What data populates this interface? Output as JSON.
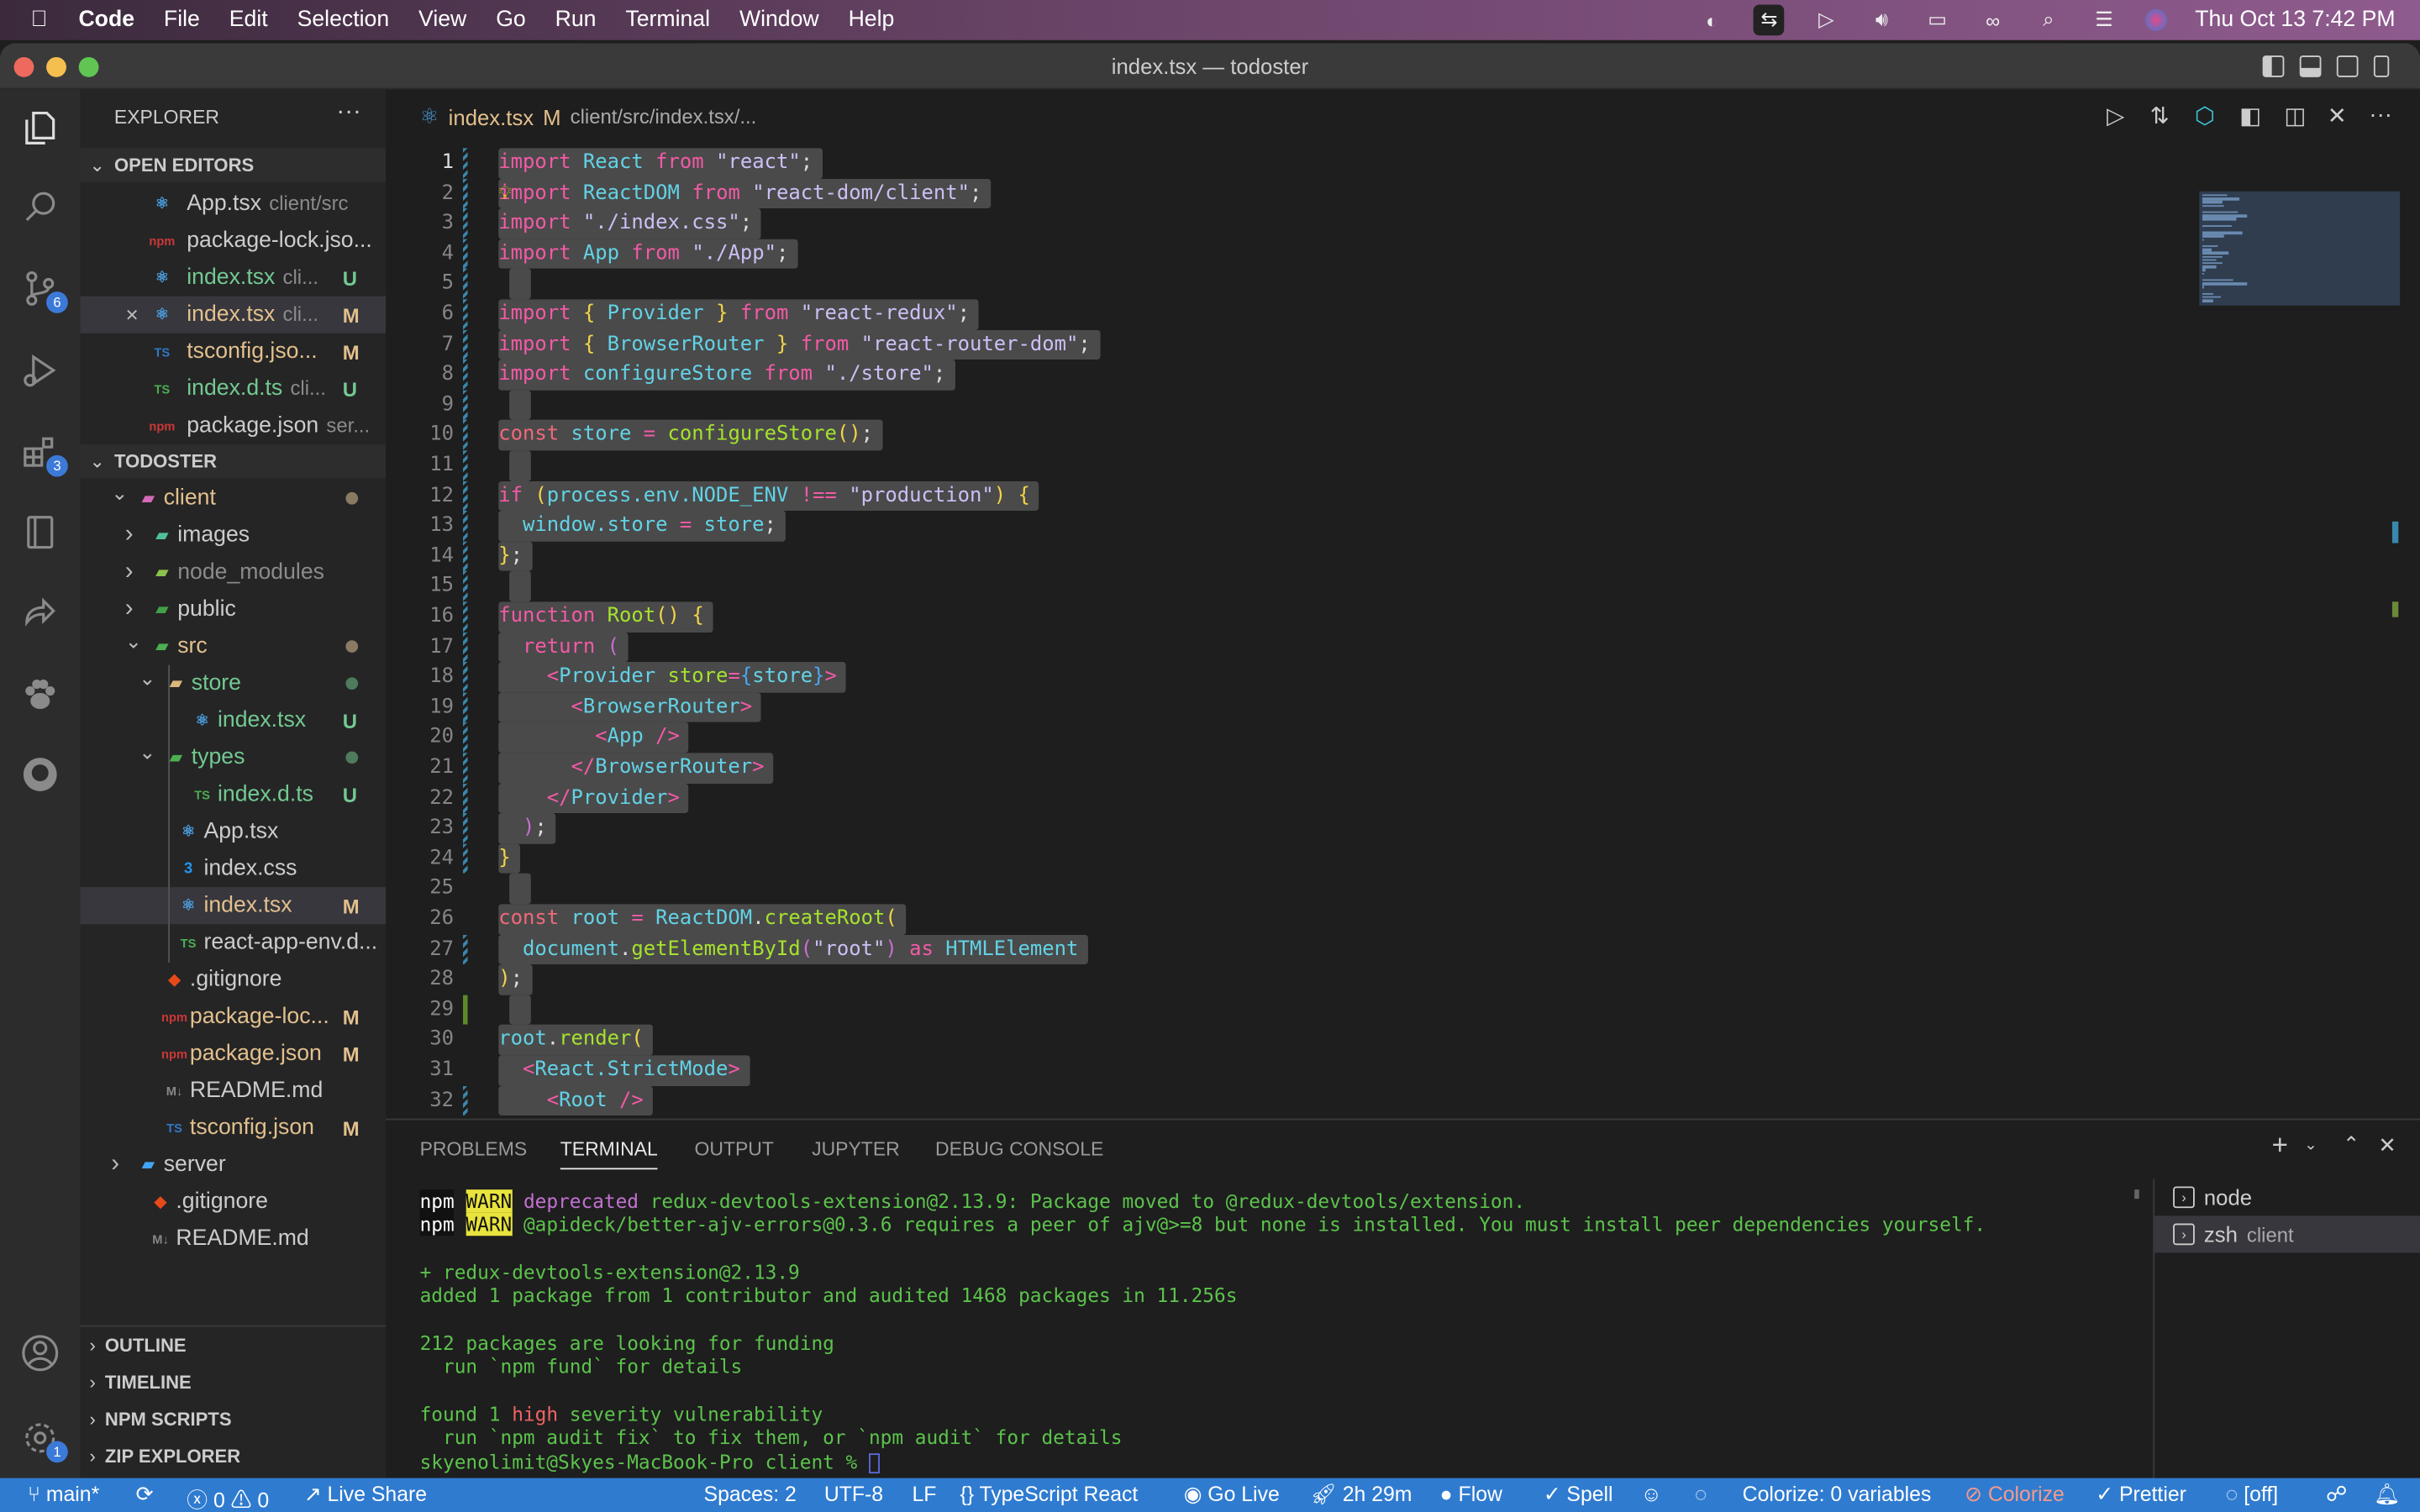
{
  "menubar": {
    "app": "Code",
    "items": [
      "File",
      "Edit",
      "Selection",
      "View",
      "Go",
      "Run",
      "Terminal",
      "Window",
      "Help"
    ],
    "datetime": "Thu Oct 13  7:42 PM"
  },
  "window": {
    "title": "index.tsx — todoster"
  },
  "activity_bar": {
    "scm_badge": "6",
    "extensions_badge": "3",
    "settings_badge": "1"
  },
  "sidebar": {
    "title": "EXPLORER",
    "open_editors_title": "OPEN EDITORS",
    "open_editors": [
      {
        "name": "App.tsx",
        "desc": "client/src",
        "status": "",
        "icon": "react-icon"
      },
      {
        "name": "package-lock.jso...",
        "desc": "",
        "status": "",
        "icon": "npm-icon"
      },
      {
        "name": "index.tsx",
        "desc": "cli...",
        "status": "U",
        "icon": "react-icon"
      },
      {
        "name": "index.tsx",
        "desc": "cli...",
        "status": "M",
        "icon": "react-icon"
      },
      {
        "name": "tsconfig.jso...",
        "desc": "",
        "status": "M",
        "icon": "tsconfig-icon"
      },
      {
        "name": "index.d.ts",
        "desc": "cli...",
        "status": "U",
        "icon": "typescript-icon"
      },
      {
        "name": "package.json",
        "desc": "ser...",
        "status": "",
        "icon": "npm-icon"
      }
    ],
    "project_title": "TODOSTER",
    "tree": [
      {
        "name": "client",
        "chev": "open",
        "status": "dot",
        "icon": "folder-client-icon"
      },
      {
        "name": "images",
        "chev": "closed",
        "status": "",
        "icon": "folder-images-icon"
      },
      {
        "name": "node_modules",
        "chev": "closed",
        "status": "",
        "icon": "folder-node-icon"
      },
      {
        "name": "public",
        "chev": "closed",
        "status": "",
        "icon": "folder-public-icon"
      },
      {
        "name": "src",
        "chev": "open",
        "status": "dot",
        "icon": "folder-src-icon"
      },
      {
        "name": "store",
        "chev": "open",
        "status": "dotU",
        "icon": "folder-icon"
      },
      {
        "name": "index.tsx",
        "chev": "",
        "status": "U",
        "icon": "react-icon"
      },
      {
        "name": "types",
        "chev": "open",
        "status": "dotU",
        "icon": "folder-types-icon"
      },
      {
        "name": "index.d.ts",
        "chev": "",
        "status": "U",
        "icon": "typescript-icon"
      },
      {
        "name": "App.tsx",
        "chev": "",
        "status": "",
        "icon": "react-icon"
      },
      {
        "name": "index.css",
        "chev": "",
        "status": "",
        "icon": "css-icon"
      },
      {
        "name": "index.tsx",
        "chev": "",
        "status": "M",
        "icon": "react-icon"
      },
      {
        "name": "react-app-env.d...",
        "chev": "",
        "status": "",
        "icon": "typescript-icon"
      },
      {
        "name": ".gitignore",
        "chev": "",
        "status": "",
        "icon": "git-icon"
      },
      {
        "name": "package-loc...",
        "chev": "",
        "status": "M",
        "icon": "npm-icon"
      },
      {
        "name": "package.json",
        "chev": "",
        "status": "M",
        "icon": "npm-icon"
      },
      {
        "name": "README.md",
        "chev": "",
        "status": "",
        "icon": "markdown-icon"
      },
      {
        "name": "tsconfig.json",
        "chev": "",
        "status": "M",
        "icon": "tsconfig-icon"
      },
      {
        "name": "server",
        "chev": "closed",
        "status": "",
        "icon": "folder-server-icon"
      },
      {
        "name": ".gitignore",
        "chev": "",
        "status": "",
        "icon": "git-icon"
      },
      {
        "name": "README.md",
        "chev": "",
        "status": "",
        "icon": "markdown-icon"
      }
    ],
    "sections": [
      "OUTLINE",
      "TIMELINE",
      "NPM SCRIPTS",
      "ZIP EXPLORER"
    ]
  },
  "editor": {
    "tab_file": "index.tsx",
    "tab_status": "M",
    "breadcrumb": "client/src/index.tsx/...",
    "lines": [
      [
        [
          "kw",
          "import"
        ],
        [
          "p",
          " "
        ],
        [
          "id",
          "React"
        ],
        [
          "p",
          " "
        ],
        [
          "kw",
          "from"
        ],
        [
          "p",
          " "
        ],
        [
          "str",
          "\"react\""
        ],
        [
          "p",
          ";"
        ]
      ],
      [
        [
          "kw",
          "import"
        ],
        [
          "p",
          " "
        ],
        [
          "id",
          "ReactDOM"
        ],
        [
          "p",
          " "
        ],
        [
          "kw",
          "from"
        ],
        [
          "p",
          " "
        ],
        [
          "str",
          "\"react-dom/client\""
        ],
        [
          "p",
          ";"
        ]
      ],
      [
        [
          "kw",
          "import"
        ],
        [
          "p",
          " "
        ],
        [
          "str",
          "\"./index.css\""
        ],
        [
          "p",
          ";"
        ]
      ],
      [
        [
          "kw",
          "import"
        ],
        [
          "p",
          " "
        ],
        [
          "id",
          "App"
        ],
        [
          "p",
          " "
        ],
        [
          "kw",
          "from"
        ],
        [
          "p",
          " "
        ],
        [
          "str",
          "\"./App\""
        ],
        [
          "p",
          ";"
        ]
      ],
      [],
      [
        [
          "kw",
          "import"
        ],
        [
          "p",
          " "
        ],
        [
          "br",
          "{"
        ],
        [
          "p",
          " "
        ],
        [
          "id",
          "Provider"
        ],
        [
          "p",
          " "
        ],
        [
          "br",
          "}"
        ],
        [
          "p",
          " "
        ],
        [
          "kw",
          "from"
        ],
        [
          "p",
          " "
        ],
        [
          "str",
          "\"react-redux\""
        ],
        [
          "p",
          ";"
        ]
      ],
      [
        [
          "kw",
          "import"
        ],
        [
          "p",
          " "
        ],
        [
          "br",
          "{"
        ],
        [
          "p",
          " "
        ],
        [
          "id",
          "BrowserRouter"
        ],
        [
          "p",
          " "
        ],
        [
          "br",
          "}"
        ],
        [
          "p",
          " "
        ],
        [
          "kw",
          "from"
        ],
        [
          "p",
          " "
        ],
        [
          "str",
          "\"react-router-dom\""
        ],
        [
          "p",
          ";"
        ]
      ],
      [
        [
          "kw",
          "import"
        ],
        [
          "p",
          " "
        ],
        [
          "id",
          "configureStore"
        ],
        [
          "p",
          " "
        ],
        [
          "kw",
          "from"
        ],
        [
          "p",
          " "
        ],
        [
          "str",
          "\"./store\""
        ],
        [
          "p",
          ";"
        ]
      ],
      [],
      [
        [
          "cn",
          "const"
        ],
        [
          "p",
          " "
        ],
        [
          "id",
          "store"
        ],
        [
          "p",
          " "
        ],
        [
          "kw",
          "="
        ],
        [
          "p",
          " "
        ],
        [
          "fn",
          "configureStore"
        ],
        [
          "br",
          "()"
        ],
        [
          "p",
          ";"
        ]
      ],
      [],
      [
        [
          "kw",
          "if"
        ],
        [
          "p",
          " "
        ],
        [
          "br",
          "("
        ],
        [
          "id",
          "process.env.NODE_ENV"
        ],
        [
          "p",
          " "
        ],
        [
          "kw",
          "!=="
        ],
        [
          "p",
          " "
        ],
        [
          "str",
          "\"production\""
        ],
        [
          "br",
          ")"
        ],
        [
          "p",
          " "
        ],
        [
          "br",
          "{"
        ]
      ],
      [
        [
          "p",
          "  "
        ],
        [
          "id",
          "window.store"
        ],
        [
          "p",
          " "
        ],
        [
          "kw",
          "="
        ],
        [
          "p",
          " "
        ],
        [
          "id",
          "store"
        ],
        [
          "p",
          ";"
        ]
      ],
      [
        [
          "br",
          "}"
        ],
        [
          "p",
          ";"
        ]
      ],
      [],
      [
        [
          "kw",
          "function"
        ],
        [
          "p",
          " "
        ],
        [
          "fn",
          "Root"
        ],
        [
          "br",
          "()"
        ],
        [
          "p",
          " "
        ],
        [
          "br",
          "{"
        ]
      ],
      [
        [
          "p",
          "  "
        ],
        [
          "kw",
          "return"
        ],
        [
          "p",
          " "
        ],
        [
          "pur",
          "("
        ]
      ],
      [
        [
          "p",
          "    "
        ],
        [
          "kw",
          "<"
        ],
        [
          "id",
          "Provider"
        ],
        [
          "p",
          " "
        ],
        [
          "fn",
          "store"
        ],
        [
          "kw",
          "="
        ],
        [
          "blu",
          "{"
        ],
        [
          "id",
          "store"
        ],
        [
          "blu",
          "}"
        ],
        [
          "kw",
          ">"
        ]
      ],
      [
        [
          "p",
          "      "
        ],
        [
          "kw",
          "<"
        ],
        [
          "id",
          "BrowserRouter"
        ],
        [
          "kw",
          ">"
        ]
      ],
      [
        [
          "p",
          "        "
        ],
        [
          "kw",
          "<"
        ],
        [
          "id",
          "App"
        ],
        [
          "p",
          " "
        ],
        [
          "kw",
          "/>"
        ]
      ],
      [
        [
          "p",
          "      "
        ],
        [
          "kw",
          "</"
        ],
        [
          "id",
          "BrowserRouter"
        ],
        [
          "kw",
          ">"
        ]
      ],
      [
        [
          "p",
          "    "
        ],
        [
          "kw",
          "</"
        ],
        [
          "id",
          "Provider"
        ],
        [
          "kw",
          ">"
        ]
      ],
      [
        [
          "p",
          "  "
        ],
        [
          "pur",
          ")"
        ],
        [
          "p",
          ";"
        ]
      ],
      [
        [
          "br",
          "}"
        ]
      ],
      [],
      [
        [
          "cn",
          "const"
        ],
        [
          "p",
          " "
        ],
        [
          "id",
          "root"
        ],
        [
          "p",
          " "
        ],
        [
          "kw",
          "="
        ],
        [
          "p",
          " "
        ],
        [
          "id",
          "ReactDOM"
        ],
        [
          "p",
          "."
        ],
        [
          "fn",
          "createRoot"
        ],
        [
          "br",
          "("
        ]
      ],
      [
        [
          "p",
          "  "
        ],
        [
          "id",
          "document"
        ],
        [
          "p",
          "."
        ],
        [
          "fn",
          "getElementById"
        ],
        [
          "pur",
          "("
        ],
        [
          "str",
          "\"root\""
        ],
        [
          "pur",
          ")"
        ],
        [
          "p",
          " "
        ],
        [
          "kw",
          "as"
        ],
        [
          "p",
          " "
        ],
        [
          "id",
          "HTMLElement"
        ]
      ],
      [
        [
          "br",
          ")"
        ],
        [
          "p",
          ";"
        ]
      ],
      [],
      [
        [
          "id",
          "root"
        ],
        [
          "p",
          "."
        ],
        [
          "fn",
          "render"
        ],
        [
          "br",
          "("
        ]
      ],
      [
        [
          "p",
          "  "
        ],
        [
          "kw",
          "<"
        ],
        [
          "id",
          "React.StrictMode"
        ],
        [
          "kw",
          ">"
        ]
      ],
      [
        [
          "p",
          "    "
        ],
        [
          "kw",
          "<"
        ],
        [
          "id",
          "Root"
        ],
        [
          "p",
          " "
        ],
        [
          "kw",
          "/>"
        ]
      ]
    ]
  },
  "panel": {
    "tabs": [
      "PROBLEMS",
      "TERMINAL",
      "OUTPUT",
      "JUPYTER",
      "DEBUG CONSOLE"
    ],
    "active_tab": "TERMINAL",
    "terminal": {
      "npm": "npm",
      "warn": "WARN",
      "l1_dep": "deprecated",
      "l1_rest": " redux-devtools-extension@2.13.9: Package moved to @redux-devtools/extension.",
      "l2_rest": " @apideck/better-ajv-errors@0.3.6 requires a peer of ajv@>=8 but none is installed. You must install peer dependencies yourself.",
      "l3": "+ redux-devtools-extension@2.13.9",
      "l4": "added 1 package from 1 contributor and audited 1468 packages in 11.256s",
      "l5": "212 packages are looking for funding",
      "l6": "  run `npm fund` for details",
      "l7_a": "found 1 ",
      "l7_high": "high",
      "l7_b": " severity vulnerability",
      "l8": "  run `npm audit fix` to fix them, or `npm audit` for details",
      "prompt": "skyenolimit@Skyes-MacBook-Pro client % "
    },
    "terminals": [
      {
        "name": "node",
        "desc": ""
      },
      {
        "name": "zsh",
        "desc": "client"
      }
    ]
  },
  "statusbar": {
    "branch": "main*",
    "errors": "0",
    "warnings": "0",
    "live_share": "Live Share",
    "spaces": "Spaces: 2",
    "encoding": "UTF-8",
    "eol": "LF",
    "language": "TypeScript React",
    "go_live": "Go Live",
    "time": "2h 29m",
    "flow": "Flow",
    "spell": "Spell",
    "colorize_vars": "Colorize: 0 variables",
    "colorize": "Colorize",
    "prettier": "Prettier",
    "off": "[off]",
    "accent": "#2f7bd0"
  }
}
